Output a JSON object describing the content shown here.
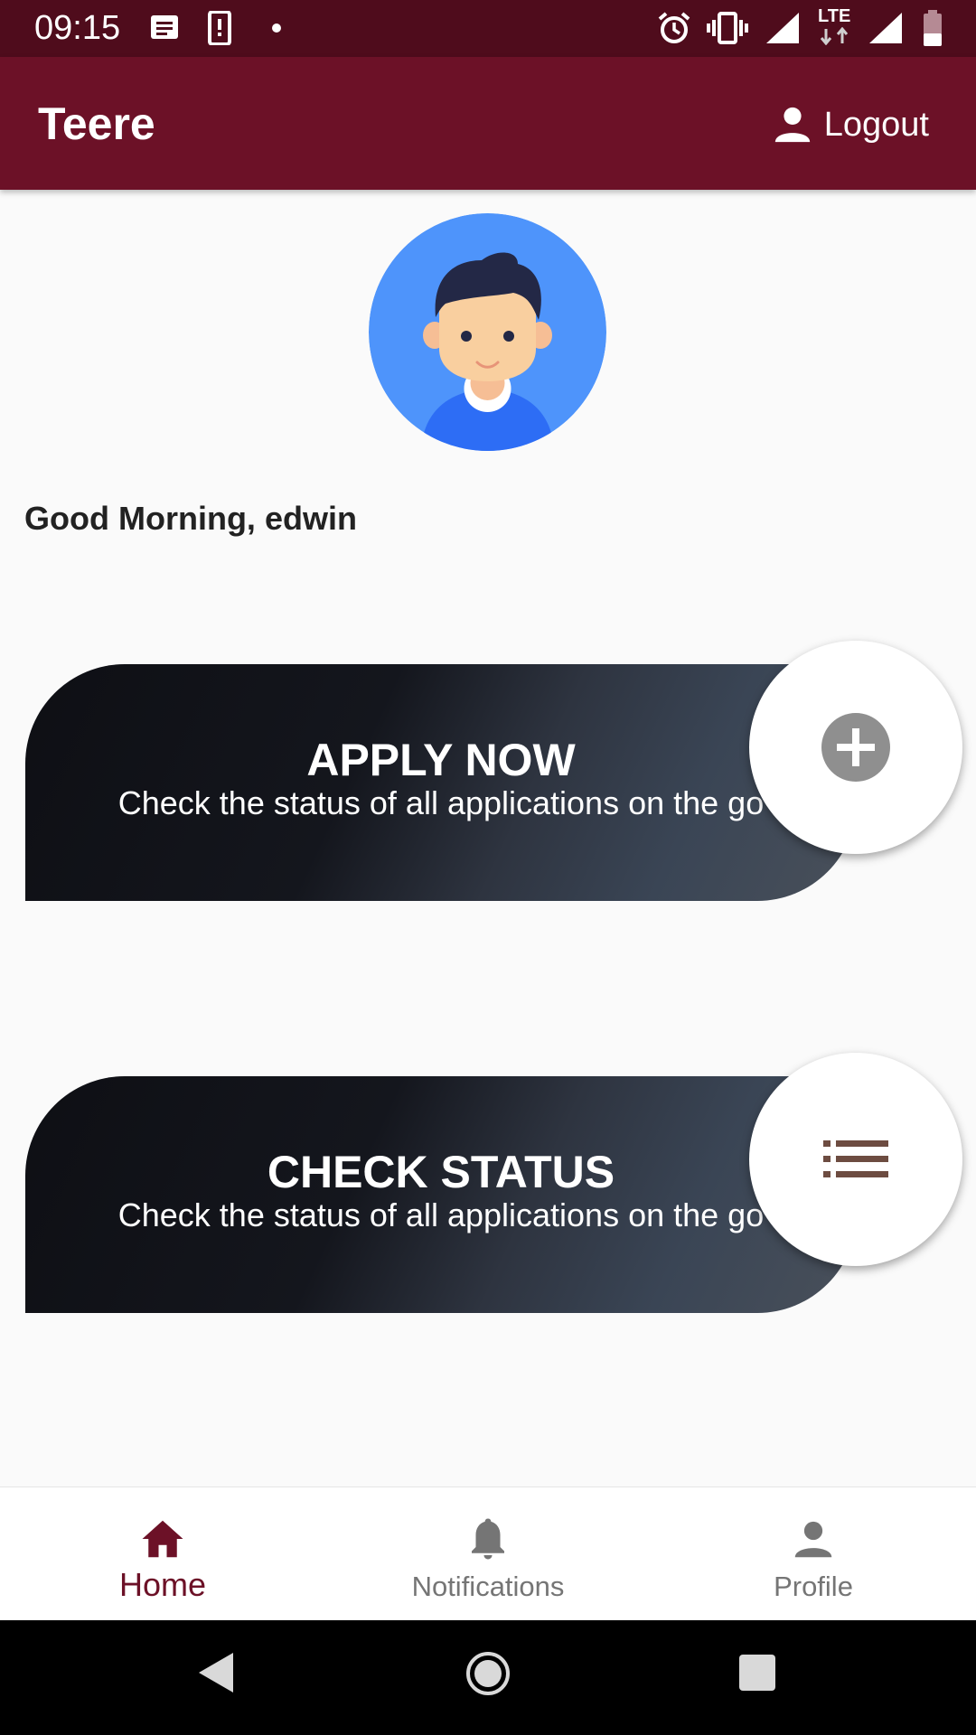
{
  "status_bar": {
    "time": "09:15",
    "left_icons": [
      "message-icon",
      "phone-alert-icon",
      "dot-icon"
    ],
    "right_icons": [
      "alarm-icon",
      "vibrate-icon",
      "signal-icon",
      "lte-icon",
      "signal-icon",
      "battery-icon"
    ],
    "network_label": "LTE"
  },
  "app_bar": {
    "title": "Teere",
    "logout_label": "Logout",
    "color": "#6c1127"
  },
  "greeting": "Good Morning, edwin",
  "cards": [
    {
      "title": "APPLY NOW",
      "subtitle": "Check the status of all applications on the go",
      "fab_icon": "add-circle-icon"
    },
    {
      "title": "CHECK STATUS",
      "subtitle": "Check the status of all applications on the go",
      "fab_icon": "list-icon"
    }
  ],
  "bottom_nav": {
    "items": [
      {
        "label": "Home",
        "icon": "home-icon",
        "active": true
      },
      {
        "label": "Notifications",
        "icon": "bell-icon",
        "active": false
      },
      {
        "label": "Profile",
        "icon": "person-icon",
        "active": false
      }
    ],
    "active_color": "#6c1127",
    "inactive_color": "#757575"
  },
  "system_nav": [
    "back-icon",
    "home-circle-icon",
    "recents-icon"
  ]
}
